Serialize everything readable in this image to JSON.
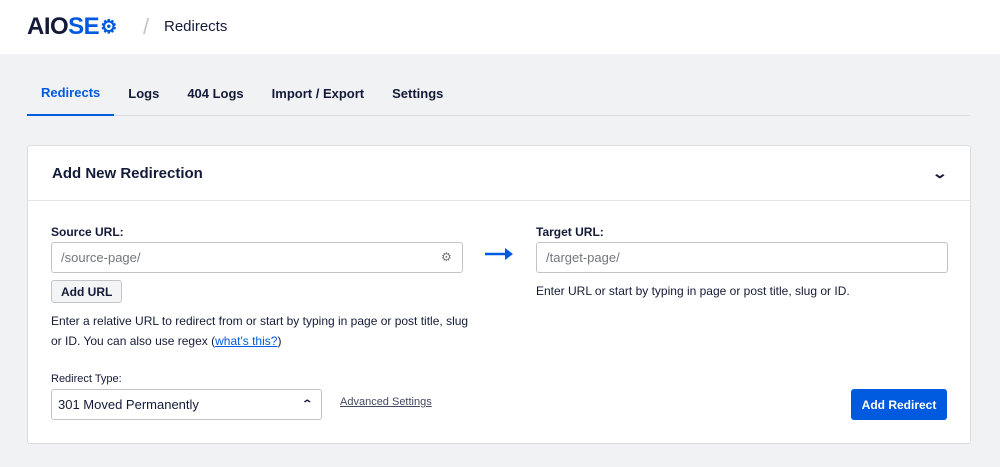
{
  "header": {
    "logo_aio": "AIO",
    "logo_seo": "SE",
    "logo_gear": "⚙",
    "separator": "/",
    "page_title": "Redirects"
  },
  "tabs": [
    {
      "label": "Redirects",
      "active": true
    },
    {
      "label": "Logs",
      "active": false
    },
    {
      "label": "404 Logs",
      "active": false
    },
    {
      "label": "Import / Export",
      "active": false
    },
    {
      "label": "Settings",
      "active": false
    }
  ],
  "card": {
    "title": "Add New Redirection",
    "source": {
      "label": "Source URL:",
      "placeholder": "/source-page/",
      "value": "",
      "add_url_label": "Add URL",
      "help_text": "Enter a relative URL to redirect from or start by typing in page or post title, slug or ID. You can also use regex (",
      "help_link": "what's this?",
      "help_close": ")"
    },
    "target": {
      "label": "Target URL:",
      "placeholder": "/target-page/",
      "value": "",
      "help_text": "Enter URL or start by typing in page or post title, slug or ID."
    },
    "redirect_type": {
      "label": "Redirect Type:",
      "selected": "301 Moved Permanently"
    },
    "advanced_settings_label": "Advanced Settings",
    "add_redirect_label": "Add Redirect"
  },
  "colors": {
    "accent": "#005ae0",
    "text": "#141b38",
    "background": "#f1f2f4"
  },
  "icons": {
    "collapse": "chevron-down-icon",
    "source_settings": "gear-icon",
    "arrow": "arrow-right-icon",
    "select_caret": "chevron-up-icon"
  }
}
